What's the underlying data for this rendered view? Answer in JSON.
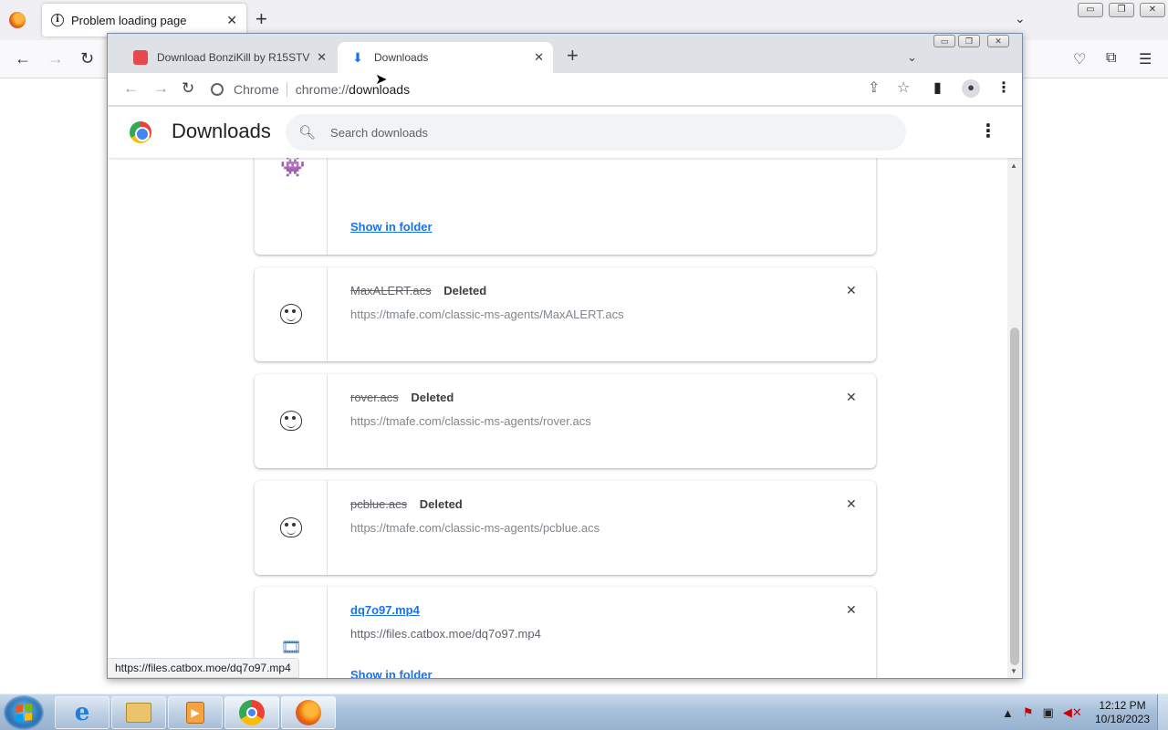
{
  "firefox": {
    "tab_title": "Problem loading page",
    "new_tab": "+",
    "tab_close": "✕",
    "tabs_list": "⌄",
    "win_minimize": "▭",
    "win_restore": "❐",
    "win_close": "✕"
  },
  "chrome": {
    "tabs": [
      {
        "title": "Download BonziKill by R15STV - ",
        "close": "✕"
      },
      {
        "title": "Downloads",
        "close": "✕"
      }
    ],
    "new_tab": "+",
    "tabs_list": "⌄",
    "win_minimize": "▭",
    "win_restore": "❐",
    "win_close": "✕",
    "omnibox": {
      "chip": "Chrome",
      "scheme": "chrome://",
      "path": "downloads"
    }
  },
  "downloads": {
    "title": "Downloads",
    "search_placeholder": "Search downloads",
    "show_in_folder": "Show in folder",
    "items": [
      {
        "filename": "MaxALERT.acs",
        "status": "Deleted",
        "url": "https://tmafe.com/classic-ms-agents/MaxALERT.acs"
      },
      {
        "filename": "rover.acs",
        "status": "Deleted",
        "url": "https://tmafe.com/classic-ms-agents/rover.acs"
      },
      {
        "filename": "pcblue.acs",
        "status": "Deleted",
        "url": "https://tmafe.com/classic-ms-agents/pcblue.acs"
      },
      {
        "filename": "dq7o97.mp4",
        "status": "",
        "url": "https://files.catbox.moe/dq7o97.mp4"
      }
    ]
  },
  "status_bar": "https://files.catbox.moe/dq7o97.mp4",
  "taskbar": {
    "time": "12:12 PM",
    "date": "10/18/2023"
  }
}
